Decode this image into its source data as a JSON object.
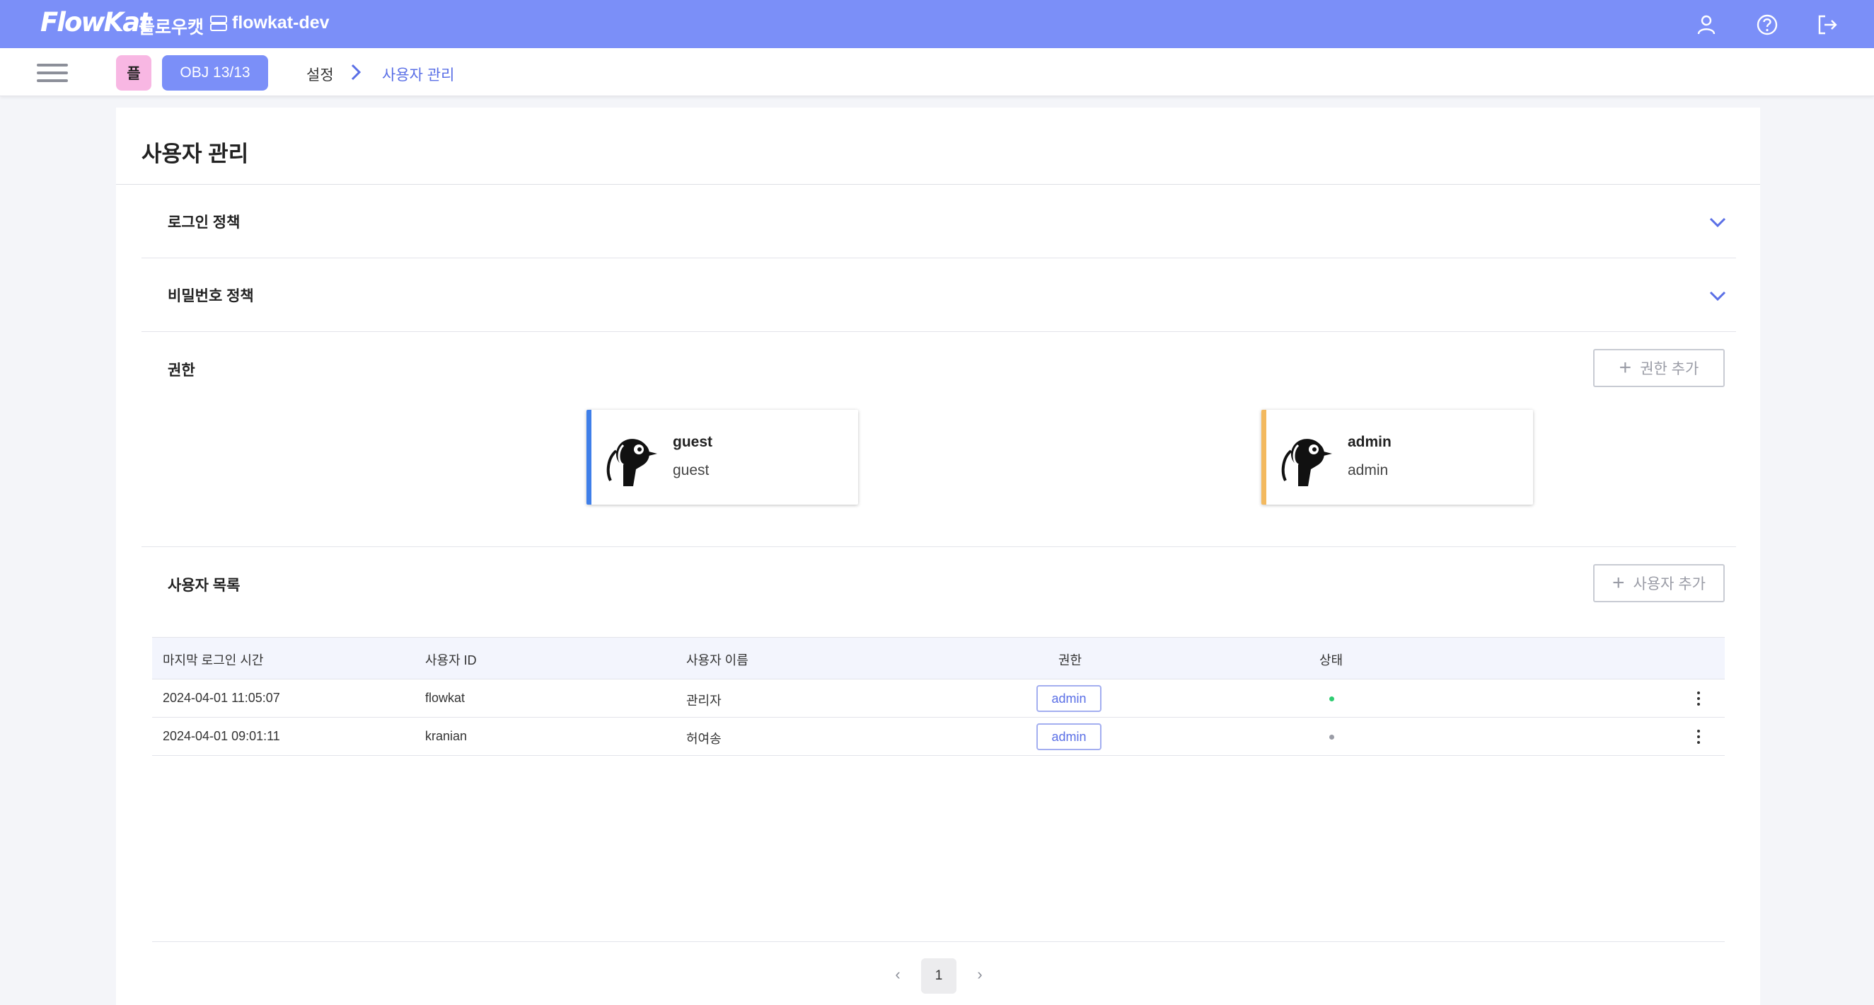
{
  "header": {
    "logo_text": "FlowKat",
    "brand_korean": "플로우캣",
    "project_name": "flowkat-dev",
    "icons": [
      "user-icon",
      "help-icon",
      "logout-icon"
    ]
  },
  "subbar": {
    "badge_label": "플",
    "obj_label": "OBJ 13/13",
    "breadcrumb": {
      "parent": "설정",
      "current": "사용자 관리"
    }
  },
  "page": {
    "title": "사용자 관리"
  },
  "sections": {
    "login_policy": "로그인 정책",
    "password_policy": "비밀번호 정책",
    "roles": "권한",
    "user_list": "사용자 목록"
  },
  "buttons": {
    "add_role": "권한 추가",
    "add_user": "사용자 추가"
  },
  "roles": [
    {
      "name": "guest",
      "description": "guest",
      "color": "#3f7fe9"
    },
    {
      "name": "admin",
      "description": "admin",
      "color": "#f3b95f"
    }
  ],
  "table": {
    "columns": [
      "마지막 로그인 시간",
      "사용자 ID",
      "사용자 이름",
      "권한",
      "상태"
    ],
    "rows": [
      {
        "last_login": "2024-04-01 11:05:07",
        "user_id": "flowkat",
        "user_name": "관리자",
        "role": "admin",
        "status_color": "#2ecc71"
      },
      {
        "last_login": "2024-04-01 09:01:11",
        "user_id": "kranian",
        "user_name": "허여송",
        "role": "admin",
        "status_color": "#9a9ca6"
      }
    ]
  },
  "pagination": {
    "prev": "‹",
    "page": "1",
    "next": "›"
  },
  "colors": {
    "accent": "#7b8ff8",
    "link": "#5a6fe6"
  }
}
